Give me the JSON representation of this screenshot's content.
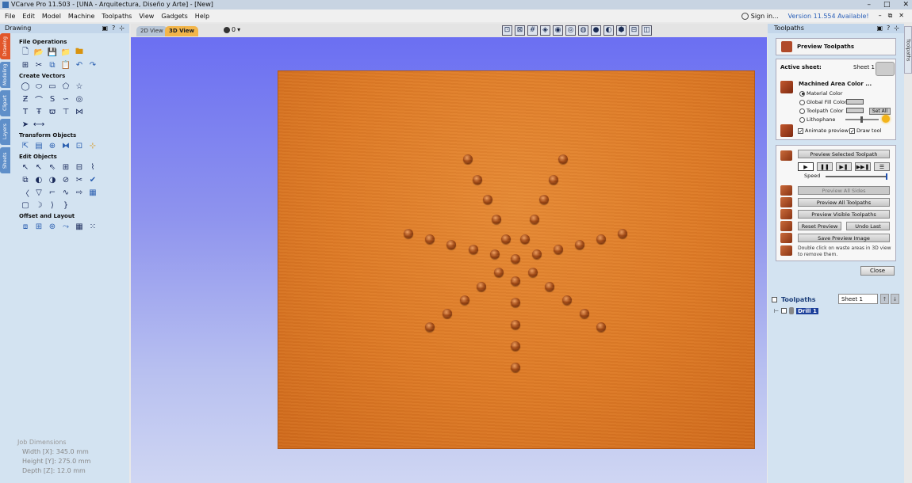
{
  "window": {
    "title": "VCarve Pro 11.503 - [UNA - Arquitectura, Diseño y Arte] - [New]",
    "controls": [
      "–",
      "□",
      "✕"
    ]
  },
  "menu": {
    "items": [
      "File",
      "Edit",
      "Model",
      "Machine",
      "Toolpaths",
      "View",
      "Gadgets",
      "Help"
    ],
    "sign_in": "Sign in...",
    "version_notice": "Version 11.554 Available!",
    "mdi_controls": [
      "–",
      "⧉",
      "✕"
    ]
  },
  "left_panel": {
    "title": "Drawing",
    "header_controls": [
      "▣",
      "?",
      "⊹"
    ],
    "side_tabs": [
      "Drawing",
      "Modeling",
      "Clipart",
      "Layers",
      "Sheets"
    ],
    "sections": {
      "file_operations": "File Operations",
      "create_vectors": "Create Vectors",
      "transform_objects": "Transform Objects",
      "edit_objects": "Edit Objects",
      "offset_layout": "Offset and Layout"
    },
    "job_dimensions": {
      "title": "Job Dimensions",
      "width": "Width  [X]: 345.0 mm",
      "height": "Height [Y]: 275.0 mm",
      "depth": "Depth  [Z]: 12.0 mm"
    }
  },
  "view_tabs": {
    "tab_2d": "2D View",
    "tab_3d": "3D View",
    "layer_label": "0"
  },
  "right_panel": {
    "title": "Toolpaths",
    "header_controls": [
      "▣",
      "?",
      "⊹"
    ],
    "side_tab": "Toolpaths",
    "preview_title": "Preview Toolpaths",
    "active_sheet_label": "Active sheet:",
    "active_sheet_value": "Sheet 1",
    "machined_area_color": "Machined Area Color ...",
    "radio_material": "Material Color",
    "radio_global_fill": "Global Fill Color",
    "radio_toolpath": "Toolpath Color",
    "radio_lithophane": "Lithophane",
    "set_all": "Set All",
    "animate_preview": "Animate preview",
    "draw_tool": "Draw tool",
    "preview_selected": "Preview Selected Toolpath",
    "play_controls": [
      "▶",
      "❚❚",
      "▶❚",
      "▶▶❚",
      "☰"
    ],
    "speed_label": "Speed",
    "preview_all_sides": "Preview All Sides",
    "preview_all_toolpaths": "Preview All Toolpaths",
    "preview_visible_toolpaths": "Preview Visible Toolpaths",
    "reset_preview": "Reset Preview",
    "undo_last": "Undo Last",
    "save_preview_image": "Save Preview Image",
    "note": "Double click on waste areas in 3D view to remove them.",
    "close": "Close",
    "toolpaths_list_title": "Toolpaths",
    "sheet_select": "Sheet 1",
    "toolpath_items": [
      "Drill 1"
    ]
  }
}
